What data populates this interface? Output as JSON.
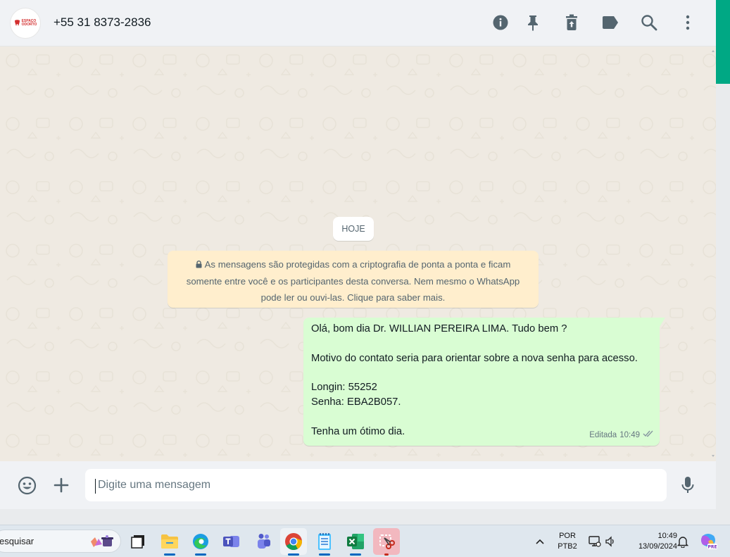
{
  "header": {
    "avatar_text": [
      "ESPAÇO",
      "ODORTO"
    ],
    "contact_name": "+55 31 8373-2836",
    "icons": [
      "info-icon",
      "pin-icon",
      "trash-icon",
      "label-icon",
      "search-icon",
      "more-icon"
    ]
  },
  "chat": {
    "date_chip": "HOJE",
    "system_message": "As mensagens são protegidas com a criptografia de ponta a ponta e ficam somente entre você e os participantes desta conversa. Nem mesmo o WhatsApp pode ler ou ouvi-las. Clique para saber mais.",
    "message": {
      "lines": [
        "Olá, bom dia Dr. WILLIAN PEREIRA LIMA. Tudo bem ?",
        "",
        "Motivo do contato seria para orientar sobre a nova senha para acesso.",
        "",
        "Longin: 55252",
        "Senha: EBA2B057.",
        "",
        "Tenha um ótimo dia."
      ],
      "edited_label": "Editada",
      "time": "10:49",
      "status": "read"
    }
  },
  "composer": {
    "placeholder": "Digite uma mensagem",
    "icons": [
      "emoji-icon",
      "plus-icon",
      "microphone-icon"
    ]
  },
  "taskbar": {
    "search_text": "esquisar",
    "apps": [
      "task-view",
      "file-explorer",
      "edge",
      "teams-work",
      "teams",
      "chrome",
      "notepad",
      "excel",
      "snipping-tool"
    ],
    "language": "POR",
    "keyboard": "PTB2",
    "time": "10:49",
    "date": "13/09/2024"
  },
  "colors": {
    "accent": "#00a884",
    "bubble_out": "#d9fdd3",
    "system_bg": "#ffeecd",
    "chat_bg": "#efeae2",
    "read_ticks": "#8696a0"
  }
}
